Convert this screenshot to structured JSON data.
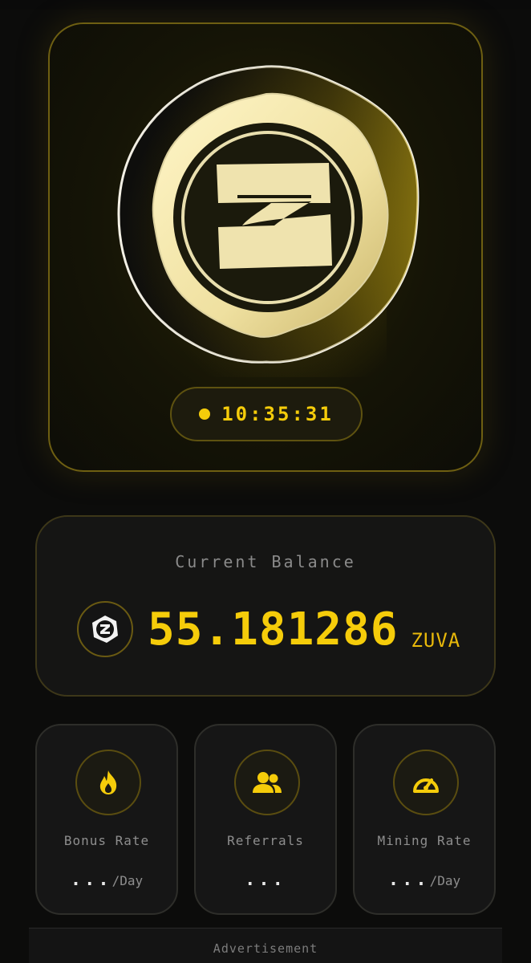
{
  "app": {
    "accent_color": "#f5cc0a",
    "background_color": "#0c0c0b"
  },
  "coin_card": {
    "logo_icon": "zuva-coin-logo",
    "timer": {
      "text": "10:35:31",
      "indicator_icon": "status-dot"
    }
  },
  "balance": {
    "label": "Current Balance",
    "token_icon": "zuva-token-icon",
    "value": "55.181286",
    "unit": "ZUVA"
  },
  "stats": [
    {
      "icon": "fire-icon",
      "label": "Bonus Rate",
      "value": "...",
      "unit": "/Day"
    },
    {
      "icon": "users-icon",
      "label": "Referrals",
      "value": "...",
      "unit": ""
    },
    {
      "icon": "speedometer-icon",
      "label": "Mining Rate",
      "value": "...",
      "unit": "/Day"
    }
  ],
  "ad": {
    "label": "Advertisement"
  }
}
